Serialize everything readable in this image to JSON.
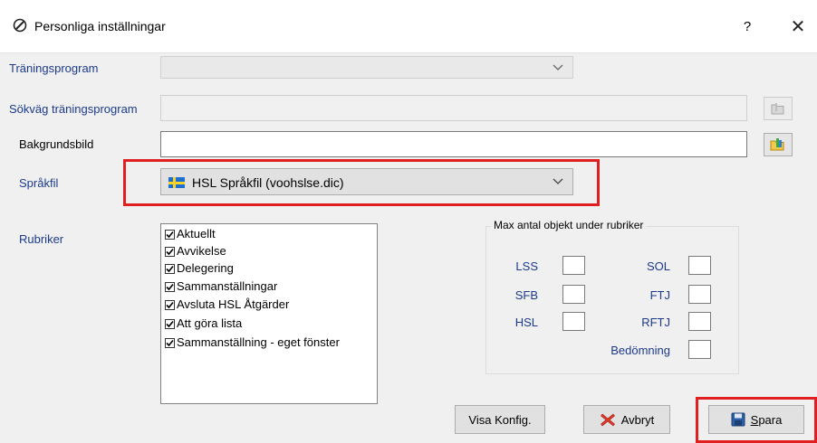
{
  "window": {
    "title": "Personliga inställningar",
    "help": "?",
    "close": "✕"
  },
  "fields": {
    "training_program_label": "Träningsprogram",
    "training_path_label": "Sökväg träningsprogram",
    "background_label": "Bakgrundsbild",
    "language_label": "Språkfil",
    "language_value": "HSL Språkfil  (voohslse.dic)",
    "headings_label": "Rubriker"
  },
  "headings": [
    {
      "label": "Aktuellt",
      "checked": true
    },
    {
      "label": "Avvikelse",
      "checked": true
    },
    {
      "label": "Delegering",
      "checked": true
    },
    {
      "label": "Sammanställningar",
      "checked": true
    },
    {
      "label": "Avsluta HSL Åtgärder",
      "checked": true
    },
    {
      "label": "Att göra lista",
      "checked": true
    },
    {
      "label": "Sammanställning - eget fönster",
      "checked": true
    }
  ],
  "max_group": {
    "title": "Max antal objekt under rubriker",
    "labels": {
      "lss": "LSS",
      "sfb": "SFB",
      "hsl": "HSL",
      "sol": "SOL",
      "ftj": "FTJ",
      "rftj": "RFTJ",
      "bedomning": "Bedömning"
    }
  },
  "buttons": {
    "visa_konfig": "Visa Konfig.",
    "avbryt": "Avbryt",
    "spara_first": "S",
    "spara_rest": "para"
  },
  "colors": {
    "highlight": "#e02020",
    "label_blue": "#1c3a8c",
    "flag_blue": "#1f6fd1",
    "flag_yellow": "#f6d32b"
  }
}
